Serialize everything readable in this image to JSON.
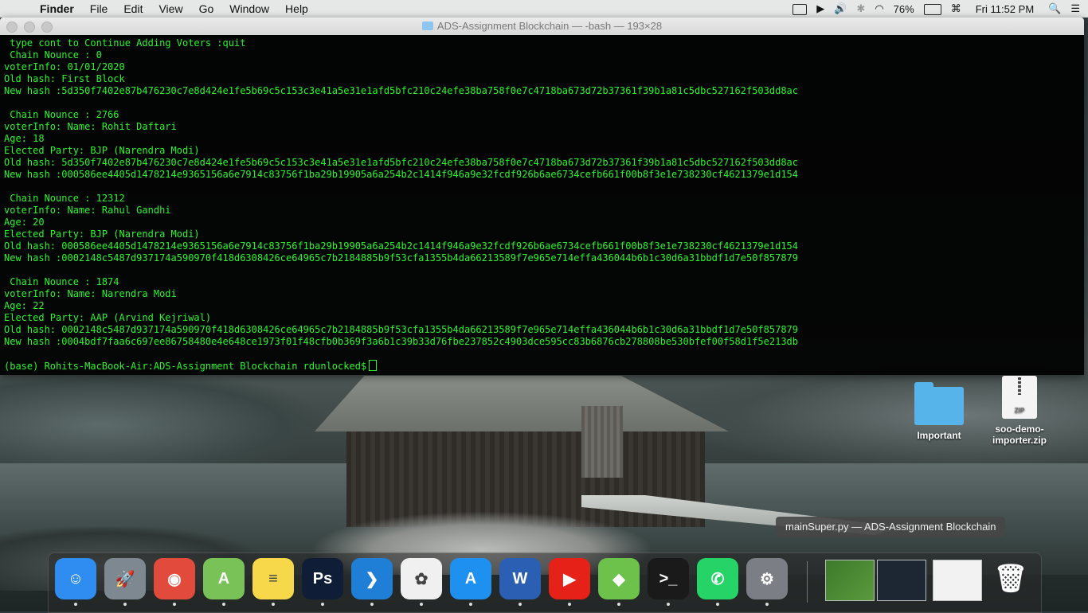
{
  "menubar": {
    "apple": "",
    "app_name": "Finder",
    "items": [
      "File",
      "Edit",
      "View",
      "Go",
      "Window",
      "Help"
    ],
    "battery": "76%",
    "clock": "Fri 11:52 PM"
  },
  "terminal": {
    "title": "ADS-Assignment Blockchain — -bash — 193×28",
    "lines": [
      " type cont to Continue Adding Voters :quit",
      " Chain Nounce : 0",
      "voterInfo: 01/01/2020",
      "Old hash: First Block",
      "New hash :5d350f7402e87b476230c7e8d424e1fe5b69c5c153c3e41a5e31e1afd5bfc210c24efe38ba758f0e7c4718ba673d72b37361f39b1a81c5dbc527162f503dd8ac",
      "",
      " Chain Nounce : 2766",
      "voterInfo: Name: Rohit Daftari",
      "Age: 18",
      "Elected Party: BJP (Narendra Modi)",
      "Old hash: 5d350f7402e87b476230c7e8d424e1fe5b69c5c153c3e41a5e31e1afd5bfc210c24efe38ba758f0e7c4718ba673d72b37361f39b1a81c5dbc527162f503dd8ac",
      "New hash :000586ee4405d1478214e9365156a6e7914c83756f1ba29b19905a6a254b2c1414f946a9e32fcdf926b6ae6734cefb661f00b8f3e1e738230cf4621379e1d154",
      "",
      " Chain Nounce : 12312",
      "voterInfo: Name: Rahul Gandhi",
      "Age: 20",
      "Elected Party: BJP (Narendra Modi)",
      "Old hash: 000586ee4405d1478214e9365156a6e7914c83756f1ba29b19905a6a254b2c1414f946a9e32fcdf926b6ae6734cefb661f00b8f3e1e738230cf4621379e1d154",
      "New hash :0002148c5487d937174a590970f418d6308426ce64965c7b2184885b9f53cfa1355b4da66213589f7e965e714effa436044b6b1c30d6a31bbdf1d7e50f857879",
      "",
      " Chain Nounce : 1874",
      "voterInfo: Name: Narendra Modi",
      "Age: 22",
      "Elected Party: AAP (Arvind Kejriwal)",
      "Old hash: 0002148c5487d937174a590970f418d6308426ce64965c7b2184885b9f53cfa1355b4da66213589f7e965e714effa436044b6b1c30d6a31bbdf1d7e50f857879",
      "New hash :0004bdf7faa6c697ee86758480e4e648ce1973f01f48cfb0b369f3a6b1c39b33d76fbe237852c4903dce595cc83b6876cb278808be530bfef00f58d1f5e213db",
      "",
      "(base) Rohits-MacBook-Air:ADS-Assignment Blockchain rdunlocked$"
    ]
  },
  "desktop": {
    "icons": [
      {
        "label": "Important"
      },
      {
        "label": "soo-demo-importer.zip",
        "badge": "ZIP"
      }
    ]
  },
  "tooltip": "mainSuper.py — ADS-Assignment Blockchain",
  "dock": {
    "apps": [
      {
        "name": "finder-icon",
        "color": "#2f8cf0",
        "glyph": "☺"
      },
      {
        "name": "launchpad-icon",
        "color": "#7d8891",
        "glyph": "🚀"
      },
      {
        "name": "chrome-icon",
        "color": "#e24a3b",
        "glyph": "◉"
      },
      {
        "name": "android-studio-icon",
        "color": "#78c257",
        "glyph": "A"
      },
      {
        "name": "notes-icon",
        "color": "#f7d84a",
        "glyph": "≡"
      },
      {
        "name": "photoshop-icon",
        "color": "#0f1e36",
        "glyph": "Ps"
      },
      {
        "name": "vscode-icon",
        "color": "#1f7ed6",
        "glyph": "❯"
      },
      {
        "name": "photos-icon",
        "color": "#f0f0f0",
        "glyph": "✿"
      },
      {
        "name": "app-store-icon",
        "color": "#1e90f0",
        "glyph": "A"
      },
      {
        "name": "word-icon",
        "color": "#2b5fb4",
        "glyph": "W"
      },
      {
        "name": "youtube-music-icon",
        "color": "#e62117",
        "glyph": "▶"
      },
      {
        "name": "box-app-icon",
        "color": "#6cc24a",
        "glyph": "◆"
      },
      {
        "name": "terminal-icon",
        "color": "#1a1a1a",
        "glyph": ">_"
      },
      {
        "name": "whatsapp-icon",
        "color": "#25d366",
        "glyph": "✆"
      },
      {
        "name": "system-preferences-icon",
        "color": "#7b7f85",
        "glyph": "⚙"
      }
    ]
  }
}
